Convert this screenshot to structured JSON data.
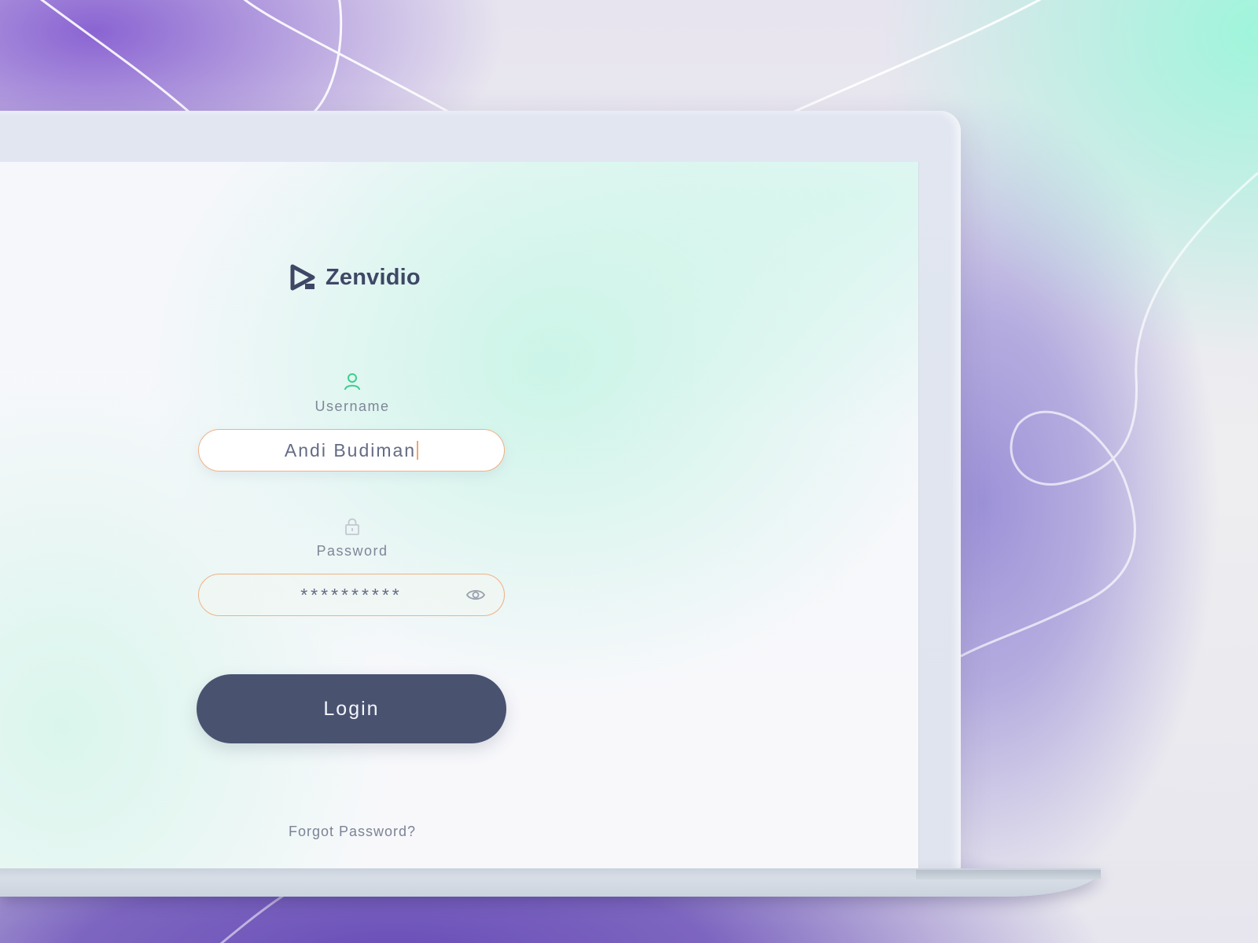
{
  "brand": {
    "name": "Zenvidio",
    "icon": "play-triangle-logo-icon",
    "color": "#3f4766"
  },
  "username": {
    "label": "Username",
    "icon": "user-icon",
    "icon_color": "#3ccf8e",
    "value": "Andi Budiman"
  },
  "password": {
    "label": "Password",
    "icon": "lock-icon",
    "value": "**********",
    "toggle_icon": "eye-icon"
  },
  "login": {
    "label": "Login",
    "color": "#495370"
  },
  "forgot": {
    "label": "Forgot Password?"
  },
  "colors": {
    "input_border": "#f0b184",
    "caret": "#f0a56d"
  }
}
